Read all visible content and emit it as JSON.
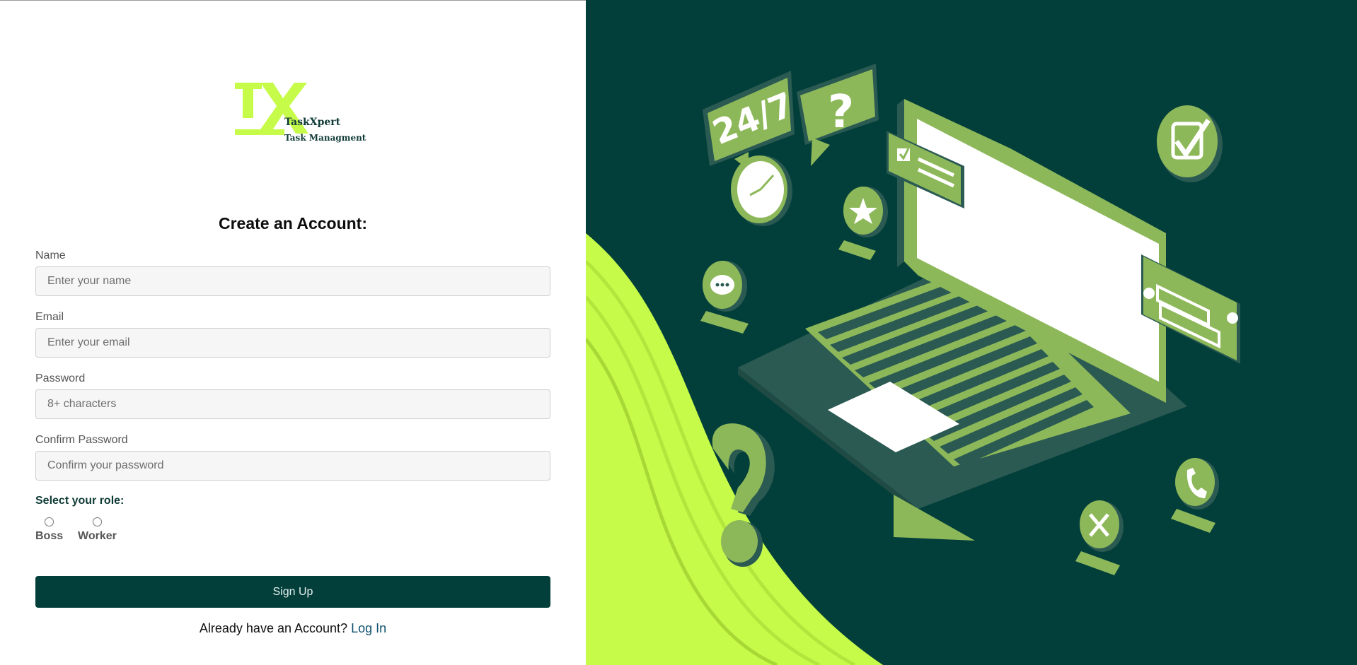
{
  "brand": {
    "name": "TaskXpert",
    "tagline": "Task Managment",
    "colors": {
      "primary": "#033f3a",
      "accent": "#c6fb4a",
      "illustration_green": "#8db85a"
    }
  },
  "form": {
    "title": "Create an Account:",
    "fields": [
      {
        "label": "Name",
        "placeholder": "Enter your name",
        "value": ""
      },
      {
        "label": "Email",
        "placeholder": "Enter your email",
        "value": ""
      },
      {
        "label": "Password",
        "placeholder": "8+ characters",
        "value": ""
      },
      {
        "label": "Confirm Password",
        "placeholder": "Confirm your password",
        "value": ""
      }
    ],
    "role": {
      "title": "Select your role:",
      "options": [
        "Boss",
        "Worker"
      ],
      "selected": null
    },
    "submit_label": "Sign Up",
    "login_prompt": "Already have an Account?",
    "login_link": "Log In"
  },
  "illustration": {
    "badge_247": "24/7",
    "icons": [
      "speech-bubble-24-7-icon",
      "question-bubble-icon",
      "clock-icon",
      "star-icon",
      "chat-icon",
      "checkmark-badge-icon",
      "laptop-icon",
      "message-card-icon",
      "question-mark-3d-icon",
      "tools-icon",
      "phone-icon"
    ]
  }
}
